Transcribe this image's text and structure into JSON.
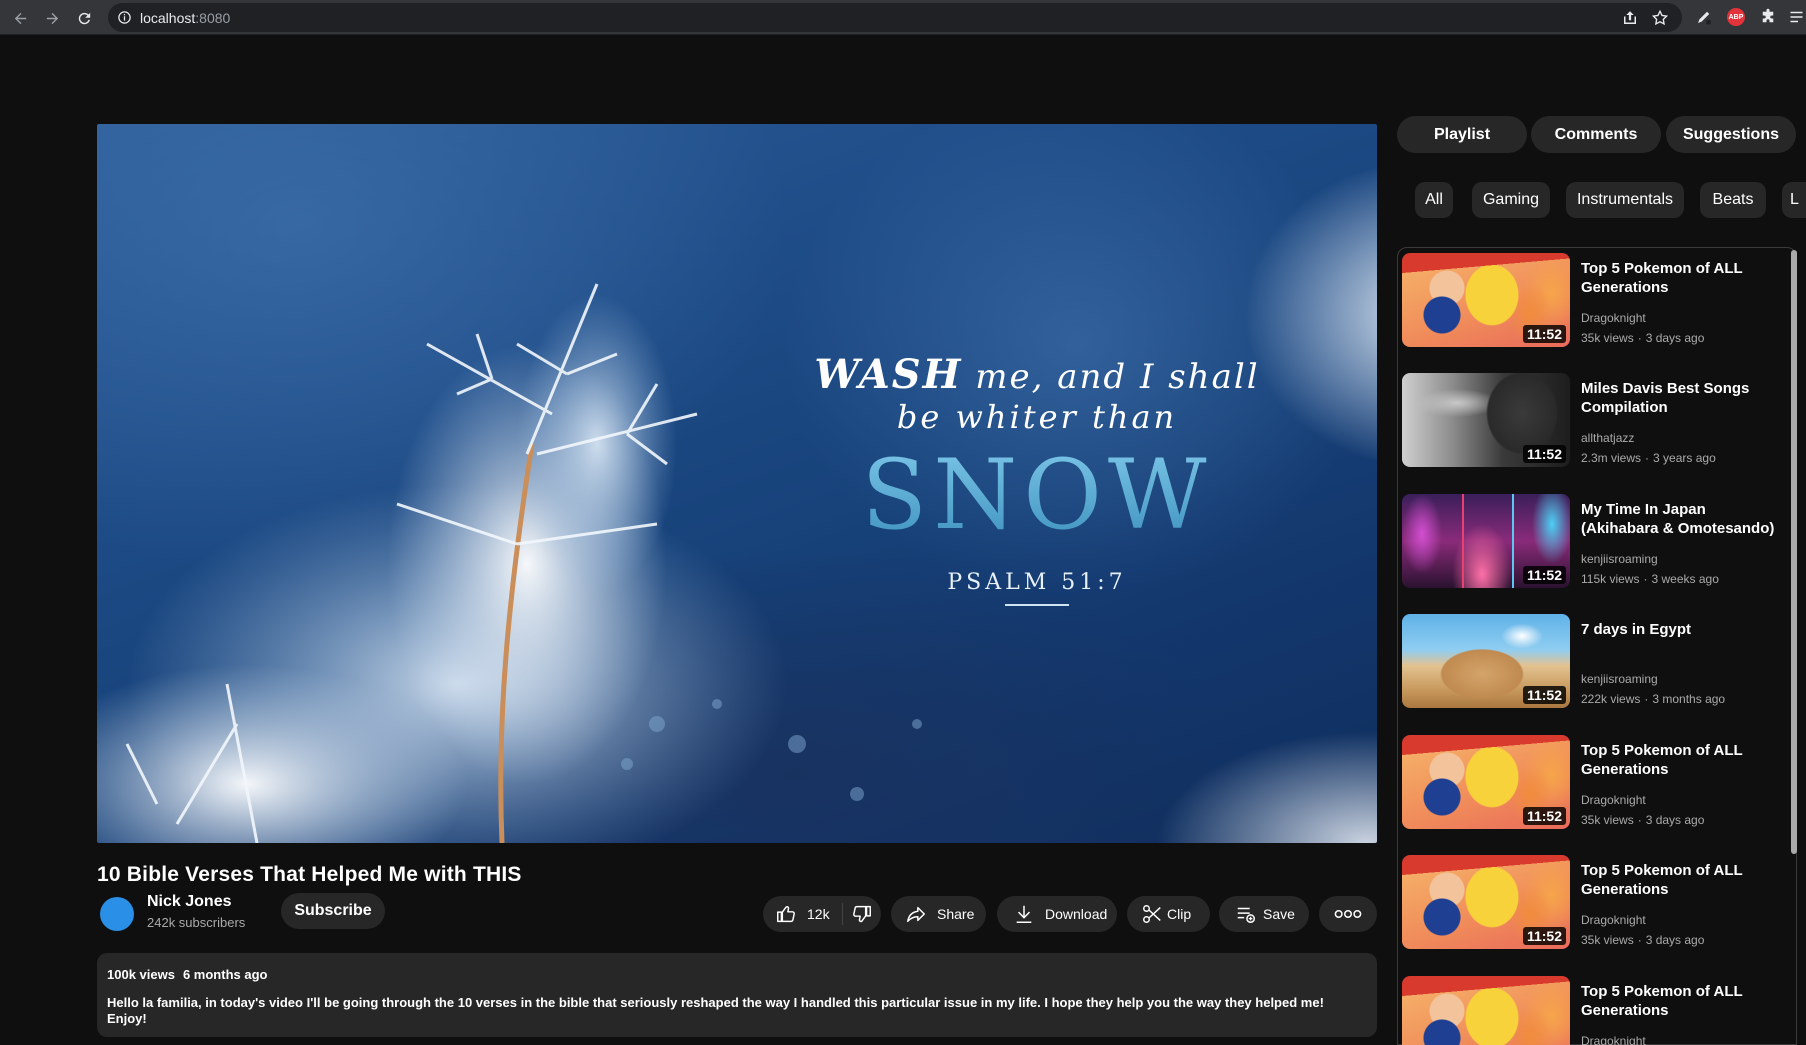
{
  "browser": {
    "url_host": "localhost",
    "url_port": ":8080"
  },
  "video": {
    "overlay": {
      "line1_emph": "WASH",
      "line1_rest": " me, and I shall",
      "line2": "be whiter than",
      "big_word": "SNOW",
      "reference": "PSALM 51:7"
    },
    "title": "10 Bible Verses That Helped Me with THIS",
    "channel": {
      "name": "Nick Jones",
      "subscribers": "242k subscribers",
      "avatar_color": "#2a8fe6"
    },
    "subscribe_label": "Subscribe",
    "actions": {
      "likes": "12k",
      "share": "Share",
      "download": "Download",
      "clip": "Clip",
      "save": "Save"
    },
    "description": {
      "views": "100k views",
      "age": "6 months ago",
      "text": "Hello la familia, in today's video I'll be going through the 10 verses in the bible that seriously reshaped the way I handled this particular issue in my life. I hope they help you the way they helped me! Enjoy!"
    }
  },
  "tabs": [
    "Playlist",
    "Comments",
    "Suggestions"
  ],
  "chips": [
    "All",
    "Gaming",
    "Instrumentals",
    "Beats",
    "L"
  ],
  "suggestions": [
    {
      "title": "Top 5 Pokemon of ALL Generations",
      "channel": "Dragoknight",
      "views": "35k views",
      "age": "3 days ago",
      "duration": "11:52",
      "thumb": "pokemon"
    },
    {
      "title": "Miles Davis Best Songs Compilation",
      "channel": "allthatjazz",
      "views": "2.3m views",
      "age": "3 years ago",
      "duration": "11:52",
      "thumb": "jazz"
    },
    {
      "title": "My Time In Japan (Akihabara & Omotesando)",
      "channel": "kenjiisroaming",
      "views": "115k views",
      "age": "3 weeks ago",
      "duration": "11:52",
      "thumb": "japan"
    },
    {
      "title": "7 days in Egypt",
      "channel": "kenjiisroaming",
      "views": "222k views",
      "age": "3 months ago",
      "duration": "11:52",
      "thumb": "egypt"
    },
    {
      "title": "Top 5 Pokemon of ALL Generations",
      "channel": "Dragoknight",
      "views": "35k views",
      "age": "3 days ago",
      "duration": "11:52",
      "thumb": "pokemon"
    },
    {
      "title": "Top 5 Pokemon of ALL Generations",
      "channel": "Dragoknight",
      "views": "35k views",
      "age": "3 days ago",
      "duration": "11:52",
      "thumb": "pokemon"
    },
    {
      "title": "Top 5 Pokemon of ALL Generations",
      "channel": "Dragoknight",
      "views": "",
      "age": "",
      "duration": "",
      "thumb": "pokemon"
    }
  ]
}
